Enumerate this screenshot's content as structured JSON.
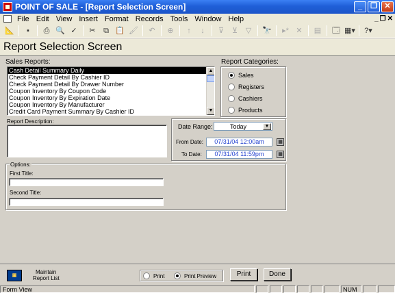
{
  "window": {
    "title": "POINT OF SALE - [Report Selection Screen]"
  },
  "menubar": {
    "items": [
      "File",
      "Edit",
      "View",
      "Insert",
      "Format",
      "Records",
      "Tools",
      "Window",
      "Help"
    ]
  },
  "screen": {
    "title": "Report Selection Screen"
  },
  "sales_reports": {
    "label": "Sales Reports:",
    "items": [
      "Cash Detail Summary Daily",
      "Check Payment Detail By Cashier ID",
      "Check Payment Detail By Drawer Number",
      "Coupon Inventory By Coupon Code",
      "Coupon Inventory By Expiration Date",
      "Coupon Inventory By Manufacturer",
      "Credit Card Payment Summary By Cashier ID"
    ],
    "selected_index": 0
  },
  "categories": {
    "label": "Report Categories:",
    "options": [
      "Sales",
      "Registers",
      "Cashiers",
      "Products"
    ],
    "selected": "Sales"
  },
  "description": {
    "label": "Report Description:",
    "value": ""
  },
  "dates": {
    "range_label": "Date Range:",
    "range_value": "Today",
    "from_label": "From Date:",
    "from_value": "07/31/04 12:00am",
    "to_label": "To Date:",
    "to_value": "07/31/04 11:59pm"
  },
  "options": {
    "label": "Options:",
    "first_title_label": "First Title:",
    "first_title_value": "",
    "second_title_label": "Second Title:",
    "second_title_value": ""
  },
  "footer": {
    "maintain_line1": "Maintain",
    "maintain_line2": "Report List",
    "print_option": "Print",
    "preview_option": "Print Preview",
    "output_selected": "Print Preview",
    "print_button": "Print",
    "done_button": "Done"
  },
  "status": {
    "left": "Form View",
    "num": "NUM"
  }
}
